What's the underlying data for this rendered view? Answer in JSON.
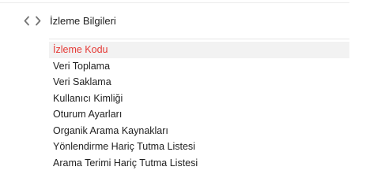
{
  "section": {
    "icon": "code-brackets-icon",
    "title": "İzleme Bilgileri"
  },
  "nav": {
    "items": [
      {
        "label": "İzleme Kodu",
        "active": true
      },
      {
        "label": "Veri Toplama",
        "active": false
      },
      {
        "label": "Veri Saklama",
        "active": false
      },
      {
        "label": "Kullanıcı Kimliği",
        "active": false
      },
      {
        "label": "Oturum Ayarları",
        "active": false
      },
      {
        "label": "Organik Arama Kaynakları",
        "active": false
      },
      {
        "label": "Yönlendirme Hariç Tutma Listesi",
        "active": false
      },
      {
        "label": "Arama Terimi Hariç Tutma Listesi",
        "active": false
      }
    ]
  },
  "colors": {
    "active_text": "#e53935",
    "active_background": "#f2f2f2",
    "icon": "#757575"
  }
}
